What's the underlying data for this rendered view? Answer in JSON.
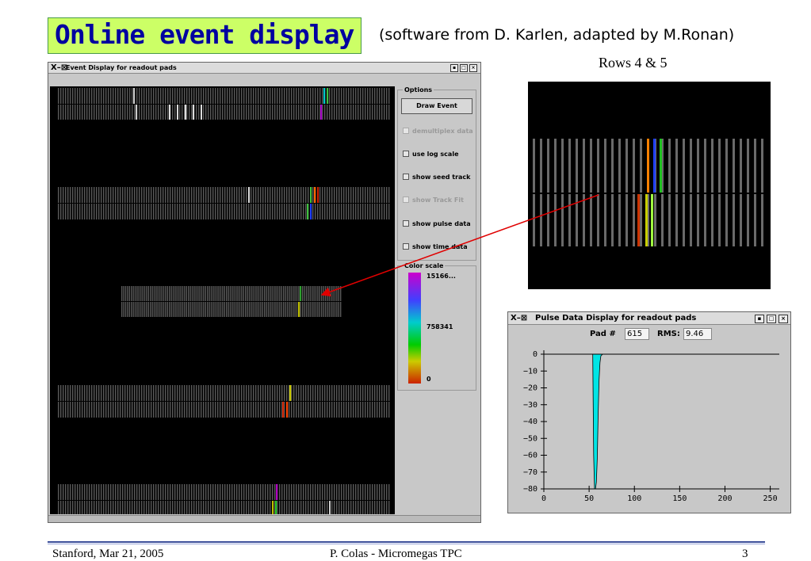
{
  "slide": {
    "title": "Online event display",
    "subtitle": "(software from D. Karlen, adapted by M.Ronan)",
    "rows_label": "Rows 4 & 5",
    "footer_left": "Stanford,  Mar 21, 2005",
    "footer_center": "P. Colas  -  Micromegas TPC",
    "footer_right": "3"
  },
  "event_window": {
    "title": "Event Display for readout pads",
    "options_legend": "Options",
    "draw_button": "Draw Event",
    "options": [
      {
        "label": "demultiplex data",
        "enabled": false
      },
      {
        "label": "use log scale",
        "enabled": true
      },
      {
        "label": "show seed track",
        "enabled": true
      },
      {
        "label": "show Track Fit",
        "enabled": false
      },
      {
        "label": "show pulse data",
        "enabled": true
      },
      {
        "label": "show time data",
        "enabled": true
      }
    ],
    "color_scale": {
      "legend": "Color scale",
      "max": "15166...",
      "mid": "758341",
      "min": "0"
    }
  },
  "pulse_window": {
    "title": "Pulse Data Display for readout pads",
    "pad_label": "Pad #",
    "pad_value": "615",
    "rms_label": "RMS:",
    "rms_value": "9.46"
  },
  "chart_data": {
    "type": "area",
    "title": "",
    "xlabel": "",
    "ylabel": "",
    "xlim": [
      0,
      260
    ],
    "ylim": [
      -80,
      0
    ],
    "x_ticks": [
      0,
      50,
      100,
      150,
      200,
      250
    ],
    "y_ticks": [
      0,
      -10,
      -20,
      -30,
      -40,
      -50,
      -60,
      -70,
      -80
    ],
    "x": [
      0,
      54,
      55,
      56,
      57,
      58,
      59,
      60,
      61,
      62,
      63,
      65,
      260
    ],
    "y": [
      0,
      0,
      -60,
      -80,
      -80,
      -76,
      -62,
      -35,
      -15,
      -5,
      -1,
      0,
      0
    ],
    "fill_color": "#00e5e5"
  }
}
